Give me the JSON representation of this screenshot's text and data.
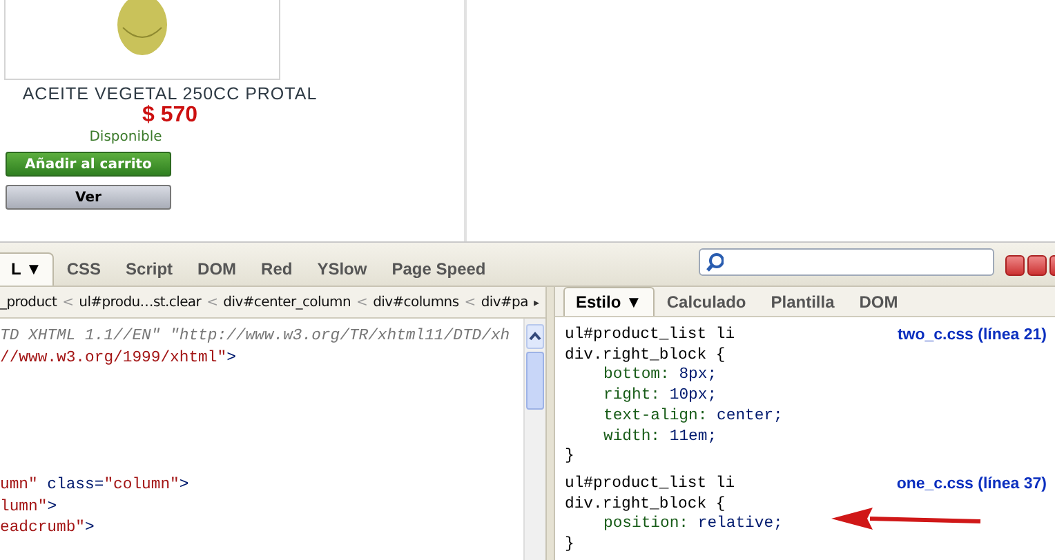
{
  "product": {
    "title": "ACEITE VEGETAL 250CC PROTAL",
    "price": "$ 570",
    "availability": "Disponible",
    "buttons": [
      {
        "label": "Añadir al carrito",
        "kind": "primary"
      },
      {
        "label": "Ver",
        "kind": "secondary"
      }
    ]
  },
  "toolbar": {
    "tabs": [
      {
        "label": "L ▼",
        "selected": true
      },
      {
        "label": "CSS",
        "selected": false
      },
      {
        "label": "Script",
        "selected": false
      },
      {
        "label": "DOM",
        "selected": false
      },
      {
        "label": "Red",
        "selected": false
      },
      {
        "label": "YSlow",
        "selected": false
      },
      {
        "label": "Page Speed",
        "selected": false
      }
    ]
  },
  "breadcrumb": {
    "items": [
      "_product",
      "ul#produ…st.clear",
      "div#center_column",
      "div#columns",
      "div#pa"
    ],
    "separator": "<",
    "more": "▸"
  },
  "html_blocks": [
    {
      "lines": [
        [
          {
            "kind": "doctype",
            "text": "TD XHTML 1.1//EN\" \"http://www.w3.org/TR/xhtml11/DTD/xh"
          }
        ],
        [
          {
            "kind": "value",
            "text": "//www.w3.org/1999/xhtml\""
          },
          {
            "kind": "tag",
            "text": ">"
          }
        ]
      ]
    },
    {
      "lines": [
        [
          {
            "kind": "value",
            "text": "umn\""
          },
          {
            "kind": "tag",
            "text": " class="
          },
          {
            "kind": "value",
            "text": "\"column\""
          },
          {
            "kind": "tag",
            "text": ">"
          }
        ],
        [
          {
            "kind": "value",
            "text": "lumn\""
          },
          {
            "kind": "tag",
            "text": ">"
          }
        ],
        [
          {
            "kind": "value",
            "text": "eadcrumb\""
          },
          {
            "kind": "tag",
            "text": ">"
          }
        ]
      ]
    }
  ],
  "side_tabs": [
    {
      "label": "Estilo ▼",
      "selected": true
    },
    {
      "label": "Calculado",
      "selected": false
    },
    {
      "label": "Plantilla",
      "selected": false
    },
    {
      "label": "DOM",
      "selected": false
    }
  ],
  "css_rules": [
    {
      "selector": [
        "ul#product_list li",
        "div.right_block {"
      ],
      "source": "two_c.css (línea 21)",
      "properties": [
        {
          "name": "bottom:",
          "value": "8px;"
        },
        {
          "name": "right:",
          "value": "10px;"
        },
        {
          "name": "text-align:",
          "value": "center;"
        },
        {
          "name": "width:",
          "value": "11em;"
        }
      ],
      "close": "}"
    },
    {
      "selector": [
        "ul#product_list li",
        "div.right_block {"
      ],
      "source": "one_c.css (línea 37)",
      "properties": [
        {
          "name": "position:",
          "value": "relative;"
        }
      ],
      "close": "}"
    }
  ]
}
